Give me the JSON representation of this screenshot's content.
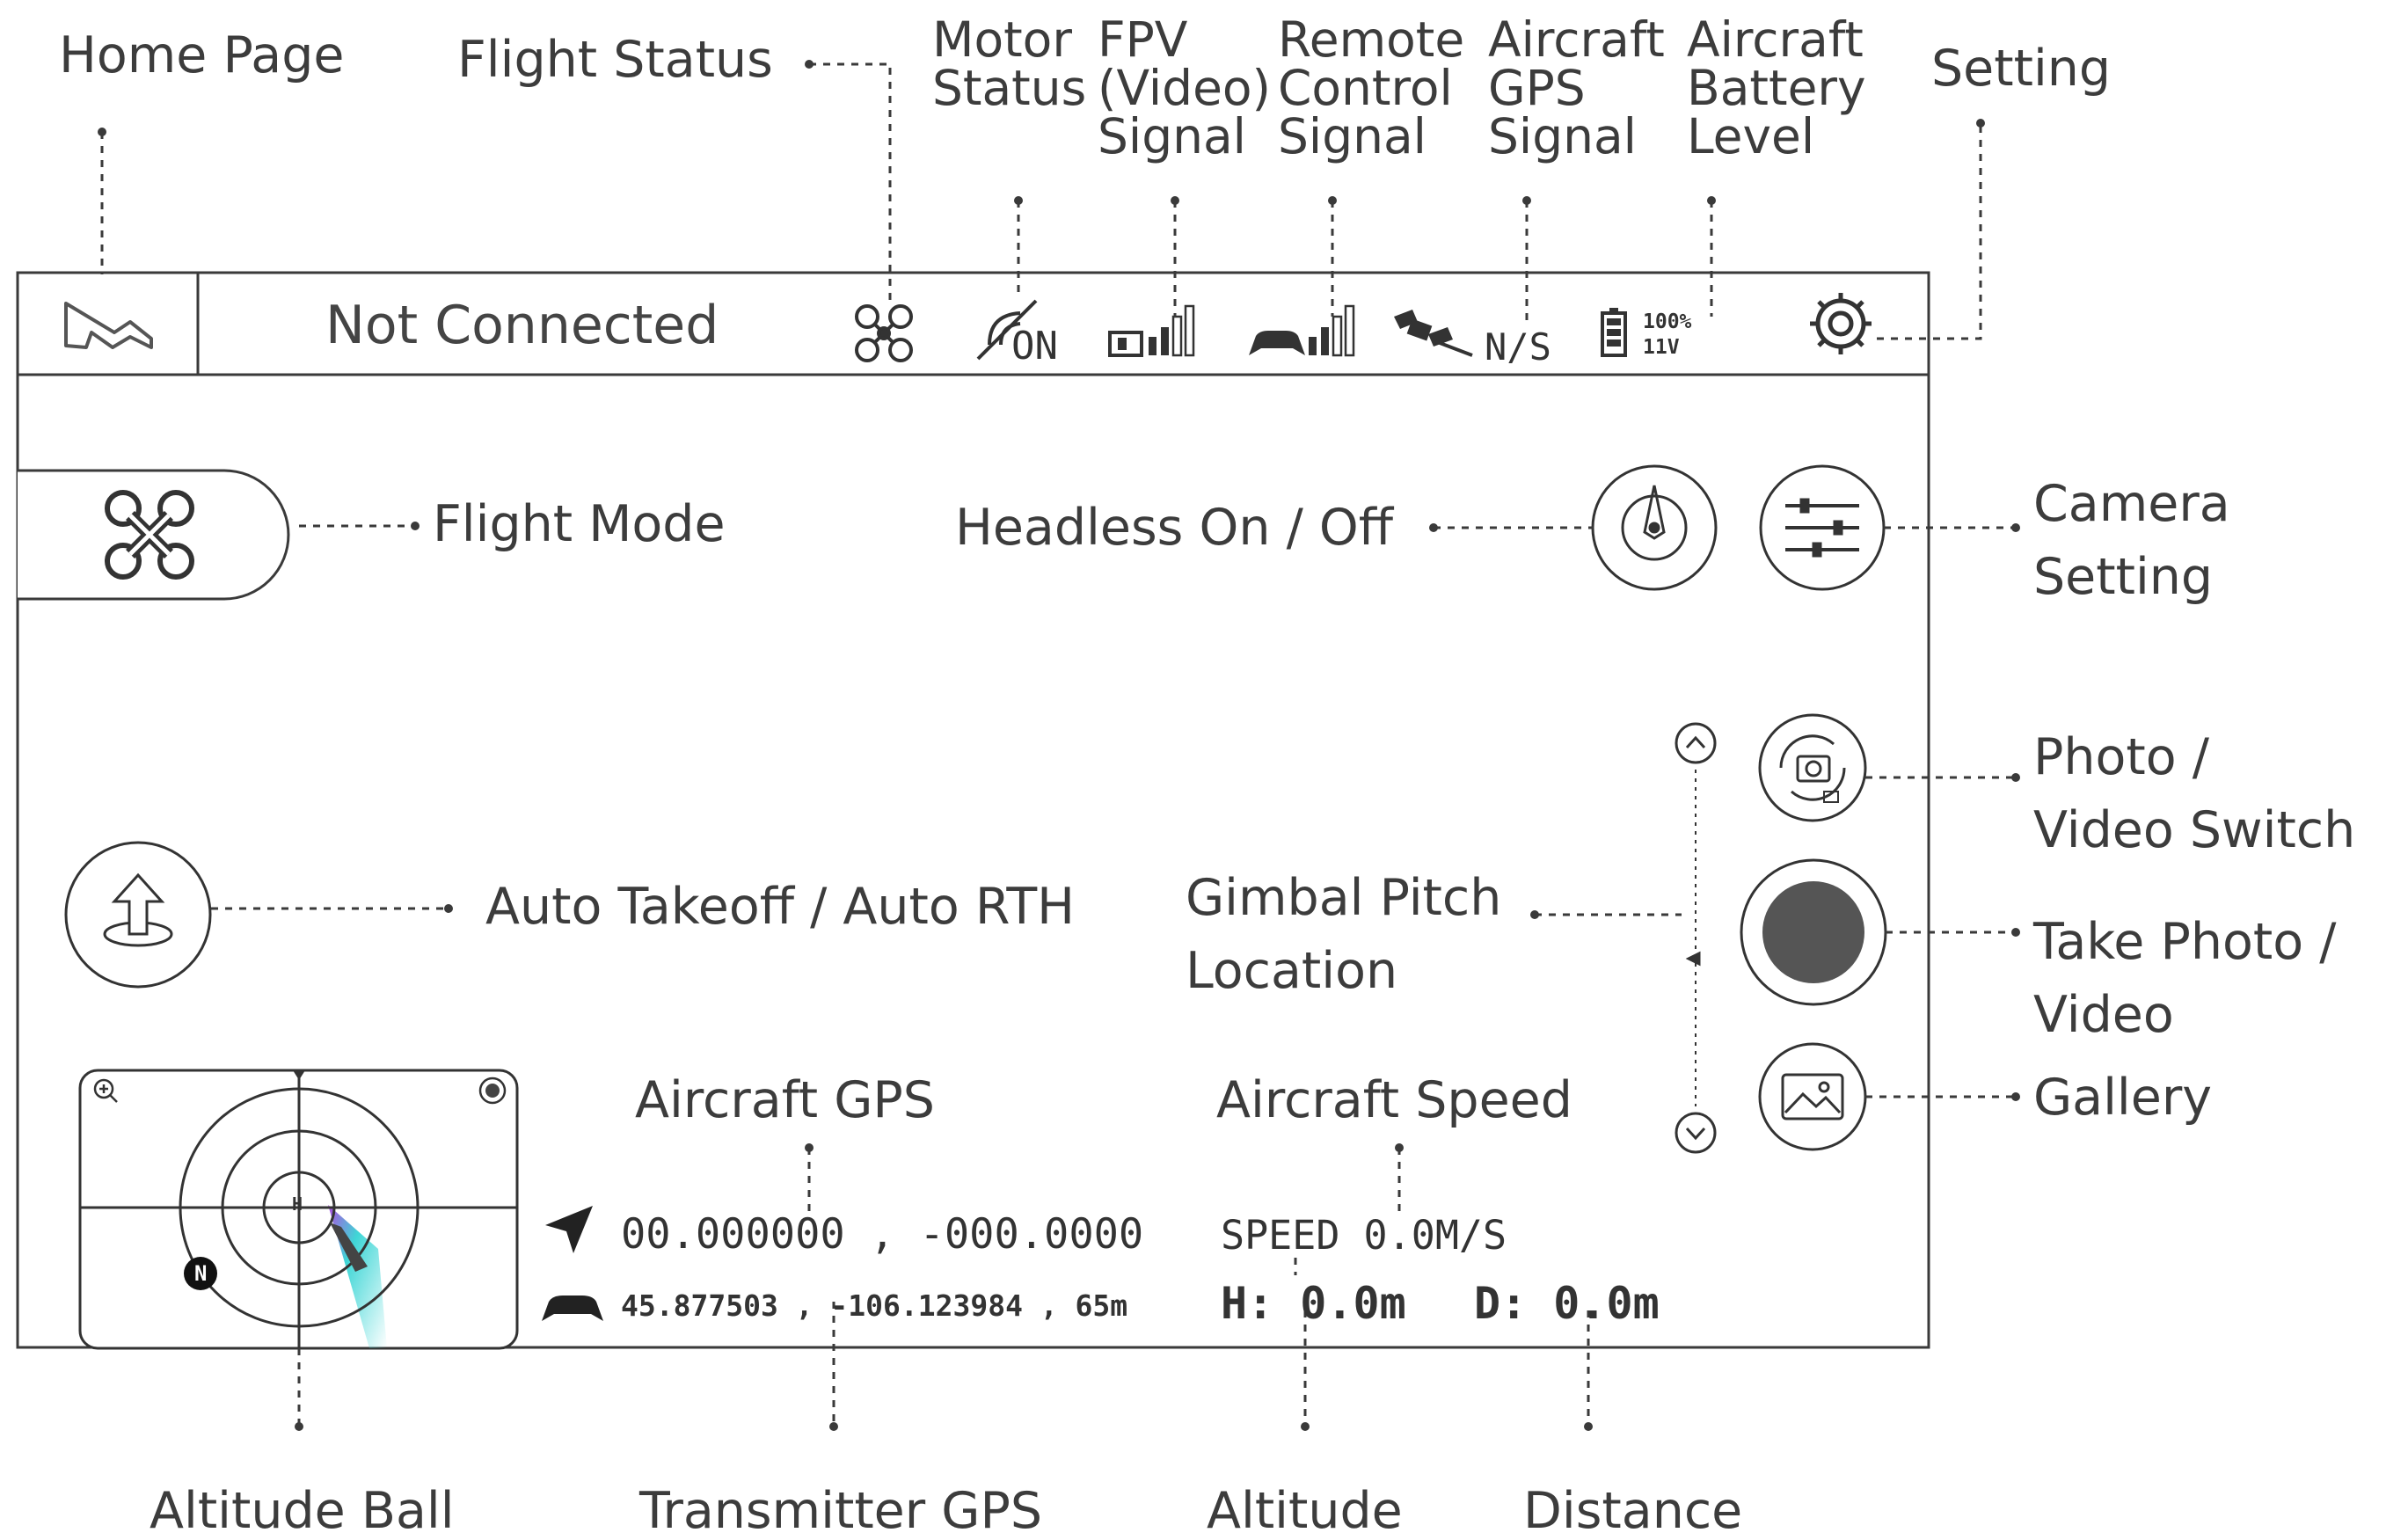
{
  "labels": {
    "home_page": "Home Page",
    "flight_status": "Flight Status",
    "motor_status": [
      "Motor",
      "Status"
    ],
    "fpv_signal": [
      "FPV",
      "(Video)",
      "Signal"
    ],
    "remote_control_signal": [
      "Remote",
      "Control",
      "Signal"
    ],
    "aircraft_gps_signal": [
      "Aircraft",
      "GPS",
      "Signal"
    ],
    "aircraft_battery_level": [
      "Aircraft",
      "Battery",
      "Level"
    ],
    "setting": "Setting",
    "flight_mode": "Flight Mode",
    "headless": "Headless On / Off",
    "camera_setting": [
      "Camera",
      "Setting"
    ],
    "photo_video_switch": [
      "Photo /",
      "Video Switch"
    ],
    "auto_takeoff": "Auto Takeoff / Auto RTH",
    "gimbal_pitch": [
      "Gimbal Pitch",
      "Location"
    ],
    "take_photo": [
      "Take Photo /",
      "Video"
    ],
    "gallery": "Gallery",
    "aircraft_gps": "Aircraft GPS",
    "aircraft_speed": "Aircraft Speed",
    "altitude_ball": "Altitude Ball",
    "transmitter_gps": "Transmitter GPS",
    "altitude": "Altitude",
    "distance": "Distance"
  },
  "screen": {
    "connection_status": "Not Connected",
    "motor_state": "ON",
    "gps_state": "N/S",
    "battery_percent": "100%",
    "battery_voltage": "11V",
    "aircraft_coords": "00.000000 , -000.0000",
    "transmitter_coords": "45.877503 , -106.123984 , 65m",
    "speed": "SPEED 0.0M/S",
    "height": "H: 0.0m",
    "distance": "D: 0.0m",
    "radar_center": "H",
    "radar_north": "N"
  },
  "colors": {
    "line": "#3a3a3a",
    "record_button": "#555555",
    "radar_cone_a": "#3fd6d6",
    "radar_cone_b": "#b04ce0"
  }
}
